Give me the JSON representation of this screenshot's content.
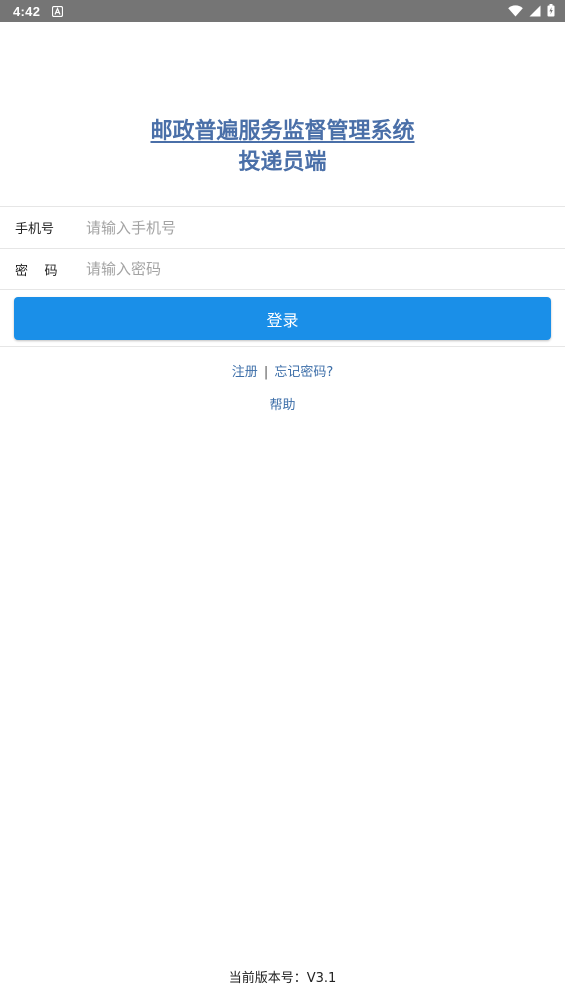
{
  "status_bar": {
    "time": "4:42",
    "notification_icon": "a-letter-icon",
    "wifi_icon": "wifi-icon",
    "signal_icon": "signal-icon",
    "battery_icon": "battery-icon"
  },
  "header": {
    "title": "邮政普遍服务监督管理系统",
    "subtitle": "投递员端"
  },
  "form": {
    "phone_label": "手机号",
    "phone_placeholder": "请输入手机号",
    "phone_value": "",
    "password_label": "密    码",
    "password_placeholder": "请输入密码",
    "password_value": ""
  },
  "actions": {
    "login_label": "登录",
    "register_label": "注册",
    "separator": "|",
    "forgot_label": "忘记密码?",
    "help_label": "帮助"
  },
  "footer": {
    "version_text": "当前版本号：V3.1"
  },
  "colors": {
    "status_bar": "#757575",
    "title": "#4a6fa8",
    "primary_button": "#1a8fe8",
    "link": "#3c6ea8"
  }
}
